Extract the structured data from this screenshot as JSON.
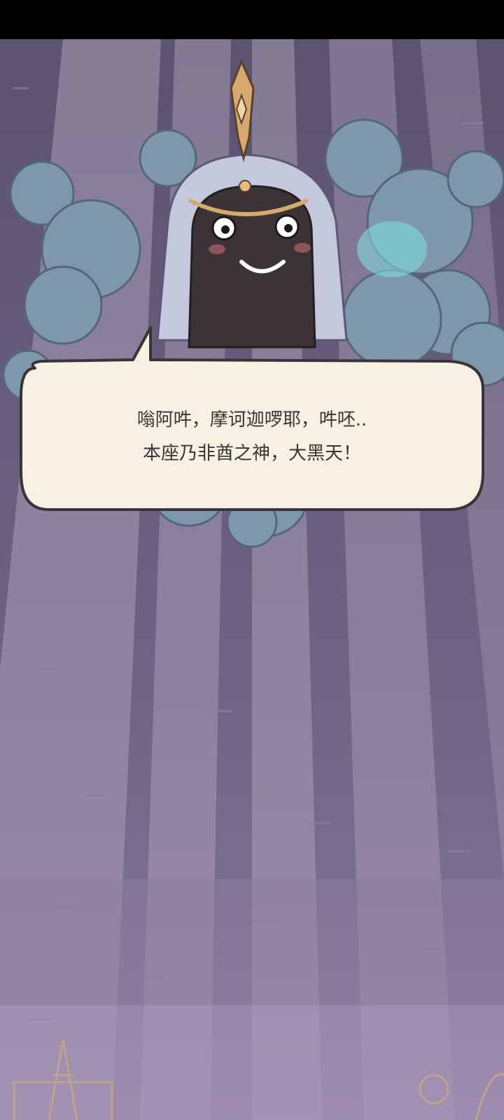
{
  "dialogue": {
    "line1": "嗡阿吽，摩诃迦啰耶，吽呸..",
    "line2": "本座乃非酋之神，大黑天！"
  },
  "character": {
    "name_icon": "mahakala-deity-icon"
  },
  "colors": {
    "sky_top": "#5c536f",
    "sky_bottom": "#9a88ad",
    "smoke": "#7f97ab",
    "bubble_fill": "#f7f1e3",
    "bubble_outline": "#3a3338",
    "deity_body": "#3b3336"
  }
}
